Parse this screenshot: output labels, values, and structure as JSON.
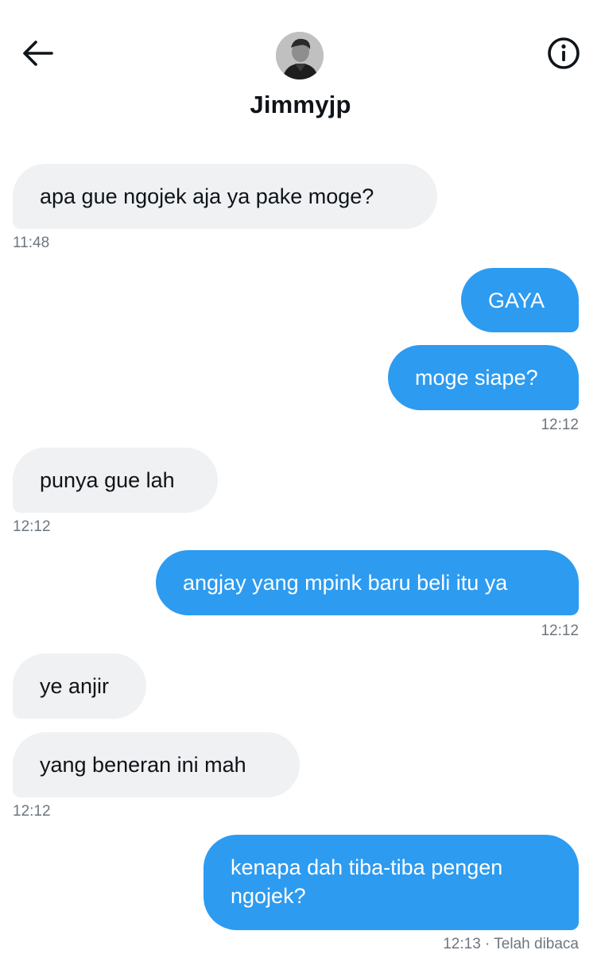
{
  "header": {
    "back_icon": "arrow-left-icon",
    "info_icon": "info-circle-icon",
    "contact_name": "Jimmyjp",
    "avatar": "contact-avatar"
  },
  "messages": [
    {
      "direction": "incoming",
      "text": "apa gue ngojek aja ya pake moge?"
    },
    {
      "direction": "incoming",
      "time": "11:48"
    },
    {
      "direction": "outgoing",
      "text": "GAYA"
    },
    {
      "direction": "outgoing",
      "text": "moge siape?"
    },
    {
      "direction": "outgoing",
      "time": "12:12"
    },
    {
      "direction": "incoming",
      "text": "punya gue lah"
    },
    {
      "direction": "incoming",
      "time": "12:12"
    },
    {
      "direction": "outgoing",
      "text": "angjay yang mpink baru beli itu ya"
    },
    {
      "direction": "outgoing",
      "time": "12:12"
    },
    {
      "direction": "incoming",
      "text": "ye anjir"
    },
    {
      "direction": "incoming",
      "text": "yang beneran ini mah"
    },
    {
      "direction": "incoming",
      "time": "12:12"
    },
    {
      "direction": "outgoing",
      "text": "kenapa dah tiba-tiba pengen ngojek?"
    },
    {
      "direction": "outgoing",
      "time": "12:13 · Telah dibaca"
    }
  ],
  "colors": {
    "outgoing_bubble": "#2d9bf0",
    "incoming_bubble": "#eff1f3",
    "timestamp": "#6d7680"
  }
}
